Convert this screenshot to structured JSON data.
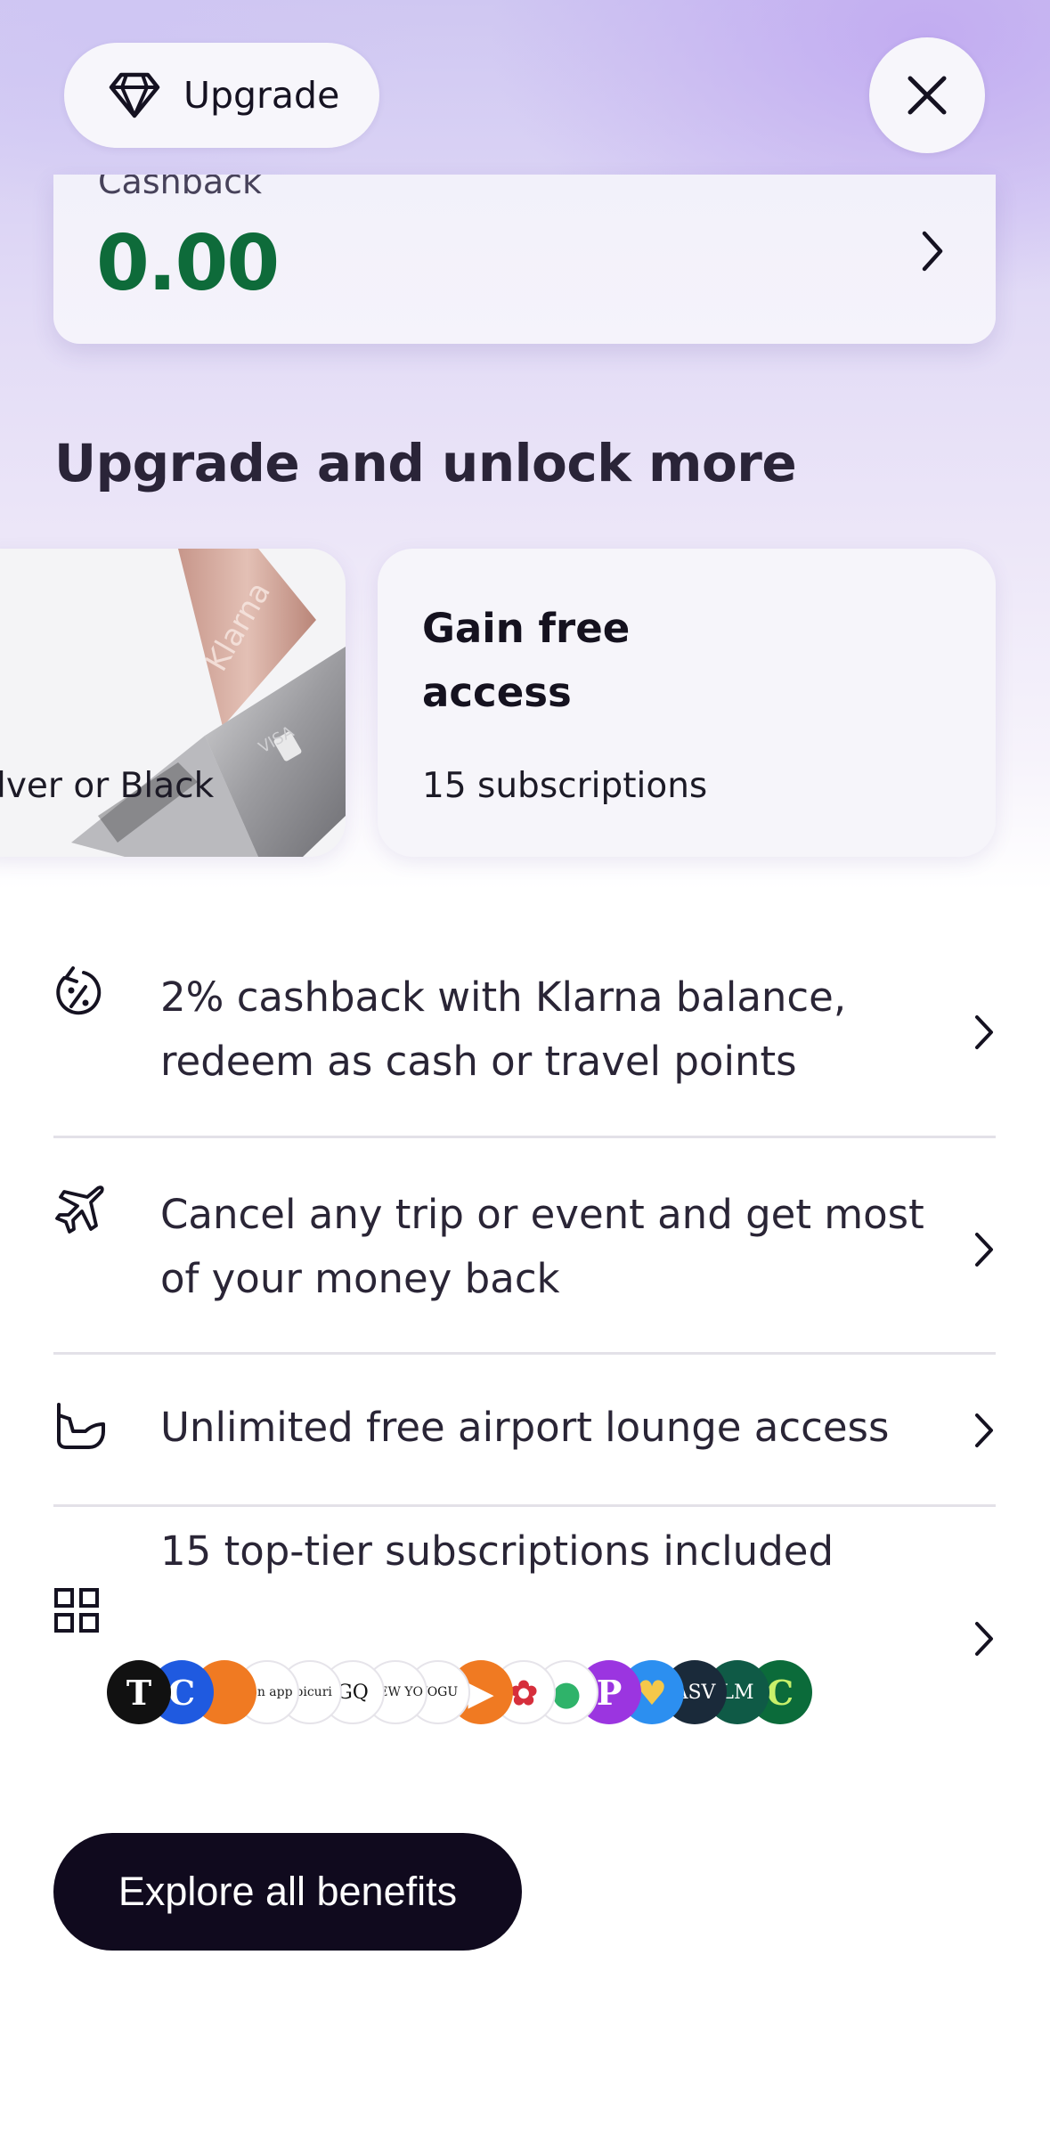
{
  "header": {
    "upgrade_label": "Upgrade",
    "upgrade_icon": "diamond-icon",
    "close_icon": "close-icon"
  },
  "cashback": {
    "label": "Cashback",
    "value": "0.00",
    "value_color": "#0e6b3a"
  },
  "section": {
    "title": "Upgrade and unlock more"
  },
  "cards": [
    {
      "caption": "Silver or Black",
      "visible_caption": "lver or Black",
      "image": "klarna-card-image"
    },
    {
      "title": "Gain free access",
      "subtitle": "15 subscriptions"
    }
  ],
  "benefits": [
    {
      "icon": "cashback-percent-icon",
      "text": "2% cashback with Klarna balance, redeem as cash or travel points"
    },
    {
      "icon": "airplane-icon",
      "text": "Cancel any trip or event and get most of your money back"
    },
    {
      "icon": "lounge-chair-icon",
      "text": "Unlimited free airport lounge access"
    },
    {
      "icon": "grid-icon",
      "text": "15 top-tier subscriptions included"
    }
  ],
  "subscription_logos": [
    {
      "name": "nyt-logo",
      "glyph": "T",
      "bg": "#111111",
      "fg": "#ffffff"
    },
    {
      "name": "c-logo",
      "glyph": "C",
      "bg": "#1f5ae0",
      "fg": "#ffffff"
    },
    {
      "name": "orange-logo",
      "glyph": "",
      "bg": "#f07a22",
      "fg": "#ffffff"
    },
    {
      "name": "bon-appetit-logo",
      "glyph": "bon app",
      "bg": "#ffffff",
      "fg": "#222222"
    },
    {
      "name": "epicurious-logo",
      "glyph": "epicuri",
      "bg": "#ffffff",
      "fg": "#222222"
    },
    {
      "name": "gq-logo",
      "glyph": "GQ",
      "bg": "#ffffff",
      "fg": "#111111"
    },
    {
      "name": "new-yorker-logo",
      "glyph": "NEW YO",
      "bg": "#ffffff",
      "fg": "#222222"
    },
    {
      "name": "vogue-logo",
      "glyph": "VOGU",
      "bg": "#ffffff",
      "fg": "#111111"
    },
    {
      "name": "play-logo",
      "glyph": "▶",
      "bg": "#f07a22",
      "fg": "#ffffff"
    },
    {
      "name": "flower-logo",
      "glyph": "✿",
      "bg": "#ffffff",
      "fg": "#d62f3c"
    },
    {
      "name": "leaf-logo",
      "glyph": "●",
      "bg": "#ffffff",
      "fg": "#2fb36a"
    },
    {
      "name": "p-logo",
      "glyph": "P",
      "bg": "#9b35e0",
      "fg": "#ffffff"
    },
    {
      "name": "heart-logo",
      "glyph": "♥",
      "bg": "#2c8ff0",
      "fg": "#f5c84a"
    },
    {
      "name": "asv-logo",
      "glyph": "ASV",
      "bg": "#1a2a3a",
      "fg": "#ffffff"
    },
    {
      "name": "lm-logo",
      "glyph": "LM",
      "bg": "#0f5a46",
      "fg": "#ffffff"
    },
    {
      "name": "green-c-logo",
      "glyph": "C",
      "bg": "#0b6b3a",
      "fg": "#c8f06a"
    }
  ],
  "cta": {
    "label": "Explore all benefits"
  }
}
